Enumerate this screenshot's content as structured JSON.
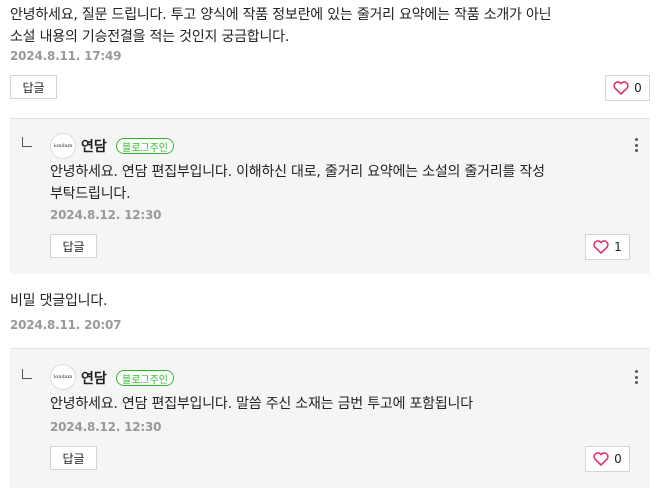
{
  "comments": [
    {
      "text_line1": "안녕하세요, 질문 드립니다. 투고 양식에 작품 정보란에 있는 줄거리 요약에는 작품 소개가 아닌",
      "text_line2": "소설 내용의 기승전결을 적는 것인지 궁금합니다.",
      "date": "2024.8.11. 17:49",
      "reply_label": "답글",
      "likes": "0",
      "reply": {
        "avatar_text": "londam",
        "author": "연담",
        "badge": "블로그주인",
        "text_line1": "안녕하세요. 연담 편집부입니다. 이해하신 대로, 줄거리 요약에는 소설의 줄거리를 작성",
        "text_line2": "부탁드립니다.",
        "date": "2024.8.12. 12:30",
        "reply_label": "답글",
        "likes": "1"
      }
    },
    {
      "text_line1": "비밀 댓글입니다.",
      "date": "2024.8.11. 20:07",
      "reply": {
        "avatar_text": "londam",
        "author": "연담",
        "badge": "블로그주인",
        "text_line1": "안녕하세요. 연담 편집부입니다. 말씀 주신 소재는 금번 투고에 포함됩니다",
        "date": "2024.8.12. 12:30",
        "reply_label": "답글",
        "likes": "0"
      }
    }
  ],
  "icons": {
    "like": "heart-icon",
    "more": "more-vertical-icon",
    "reply_indicator": "reply-arrow-icon"
  },
  "colors": {
    "heart": "#e2336b",
    "badge": "#2eb82e",
    "date": "#999999"
  }
}
